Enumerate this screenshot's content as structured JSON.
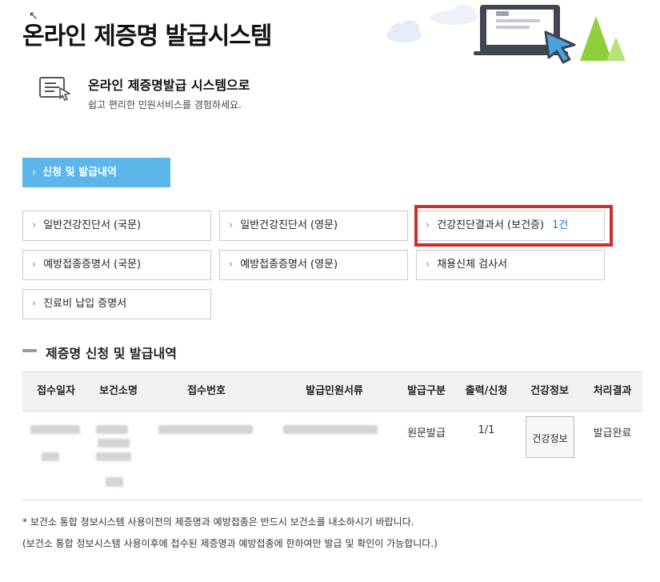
{
  "header": {
    "title": "온라인 제증명 발급시스템",
    "intro_title": "온라인 제증명발급 시스템으로",
    "intro_subtitle": "쉽고 편리한 민원서비스를 경험하세요."
  },
  "tabs": {
    "active_label": "신청 및 발급내역",
    "chevron": "›"
  },
  "documents": [
    {
      "label": "일반건강진단서 (국문)"
    },
    {
      "label": "일반건강진단서 (영문)"
    },
    {
      "label": "건강진단결과서 (보건증)",
      "count": "1건",
      "highlighted": true
    },
    {
      "label": "예방접종증명서 (국문)"
    },
    {
      "label": "예방접종증명서 (영문)"
    },
    {
      "label": "채용신체 검사서"
    },
    {
      "label": "진료비 납입 증명서"
    }
  ],
  "section": {
    "title": "제증명 신청 및 발급내역"
  },
  "table": {
    "columns": [
      "접수일자",
      "보건소명",
      "접수번호",
      "발급민원서류",
      "발급구분",
      "출력/신청",
      "건강정보",
      "처리결과"
    ],
    "rows": [
      {
        "receipt_date": "",
        "health_center": "",
        "receipt_number": "",
        "document": "",
        "issue_type": "원문발급",
        "print_apply": "1/1",
        "health_info_button": "건강정보",
        "result": "발급완료"
      }
    ]
  },
  "notes": [
    "* 보건소 통합 정보시스템 사용이전의 제증명과 예방접종은 반드시 보건소를 내소하시기 바랍니다.",
    "(보건소 통합 정보시스템 사용이후에 접수된 제증명과 예방접종에 한하여만 발급 및 확인이 가능합니다.)"
  ],
  "colors": {
    "tab_active": "#5db6ea",
    "highlight_border": "#c9302c",
    "count_text": "#2a6fd1",
    "header_art_tree": "#8fcf3c"
  },
  "icons": [
    "cursor-icon",
    "document-icon",
    "laptop-icon",
    "pointer-icon",
    "cloud-icon",
    "tree-icon",
    "chevron-right-icon"
  ]
}
